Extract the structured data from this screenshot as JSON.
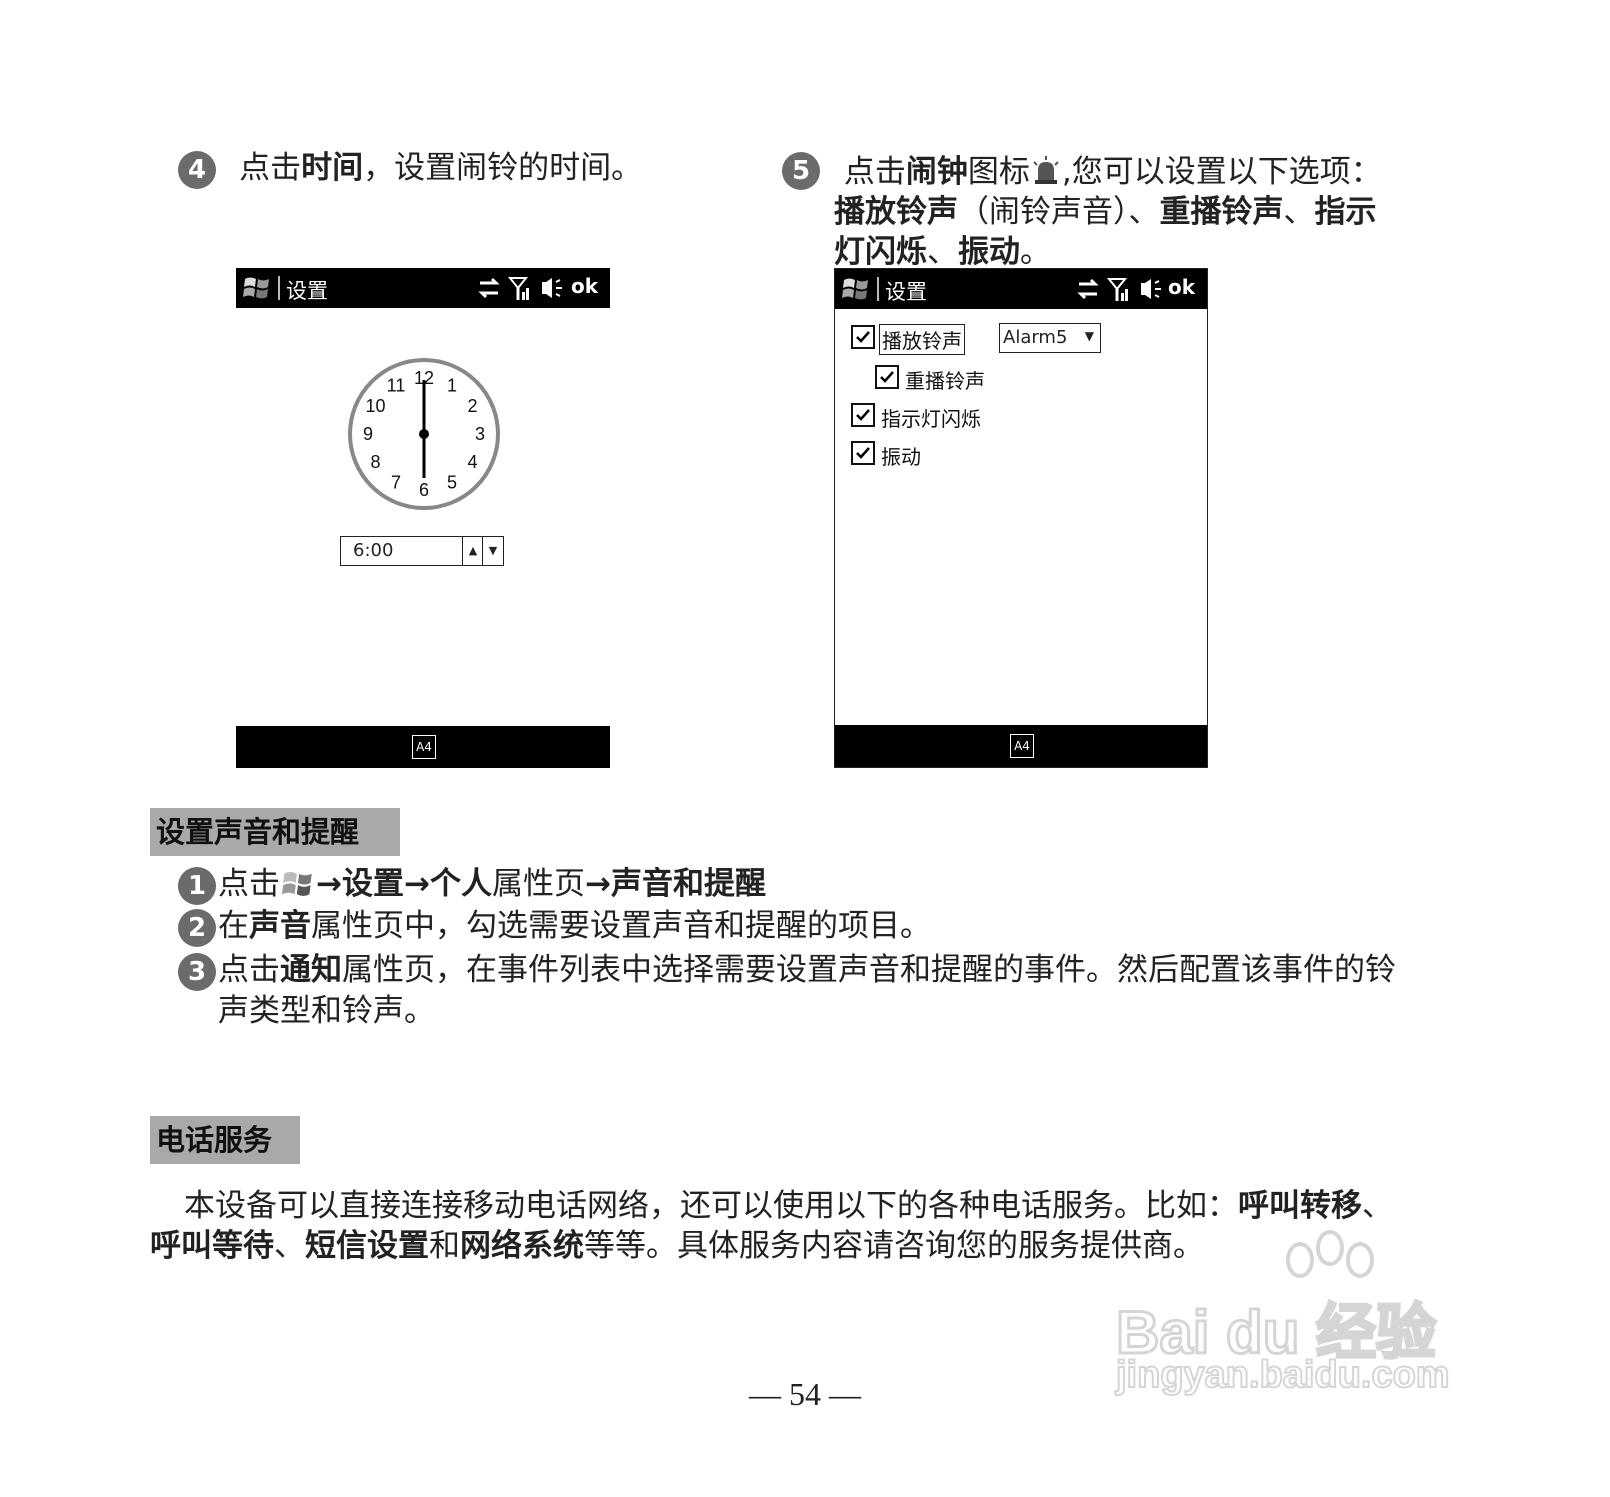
{
  "step4": {
    "num": "4",
    "t1": "点击",
    "t2": "时间",
    "t3": "，设置闹铃的时间。"
  },
  "step5": {
    "num": "5",
    "t1": "点击",
    "t2": "闹钟",
    "t3": "图标",
    "t4": ",您可以设置以下选项：",
    "t5": "播放铃声",
    "t6": "（闹铃声音）、",
    "t7": "重播铃声",
    "t8": "、",
    "t9": "指示",
    "t10": "灯闪烁",
    "t11": "、",
    "t12": "振动",
    "t13": "。"
  },
  "screen1": {
    "title": "设置",
    "ok": "ok",
    "clock_numbers": [
      "12",
      "1",
      "2",
      "3",
      "4",
      "5",
      "6",
      "7",
      "8",
      "9",
      "10",
      "11"
    ],
    "time_value": "6:00",
    "input_label": "A4"
  },
  "screen2": {
    "title": "设置",
    "ok": "ok",
    "options": {
      "play_ringtone": "播放铃声",
      "ringtone_value": "Alarm5",
      "repeat_ringtone": "重播铃声",
      "indicator_light": "指示灯闪烁",
      "vibrate": "振动"
    },
    "input_label": "A4"
  },
  "section1": {
    "heading": "设置声音和提醒",
    "item1": {
      "num": "1",
      "t1": "点击",
      "arrow1": "→",
      "t2": "设置",
      "arrow2": "→",
      "t3": "个人",
      "t4": "属性页",
      "arrow3": "→",
      "t5": "声音和提醒"
    },
    "item2": {
      "num": "2",
      "t1": "在",
      "t2": "声音",
      "t3": "属性页中，勾选需要设置声音和提醒的项目。"
    },
    "item3": {
      "num": "3",
      "t1": "点击",
      "t2": "通知",
      "t3": "属性页，在事件列表中选择需要设置声音和提醒的事件。然后配置该事件的铃",
      "t4": "声类型和铃声。"
    }
  },
  "section2": {
    "heading": "电话服务",
    "p1": "本设备可以直接连接移动电话网络，还可以使用以下的各种电话服务。比如：",
    "b1": "呼叫转移",
    "s1": "、",
    "b2": "呼叫等待",
    "s2": "、",
    "b3": "短信设置",
    "s3": "和",
    "b4": "网络系统",
    "s4": "等等。具体服务内容请咨询您的服务提供商。"
  },
  "page_number": "— 54 —",
  "watermark": {
    "brand": "Bai du 经验",
    "url": "jingyan.baidu.com"
  }
}
